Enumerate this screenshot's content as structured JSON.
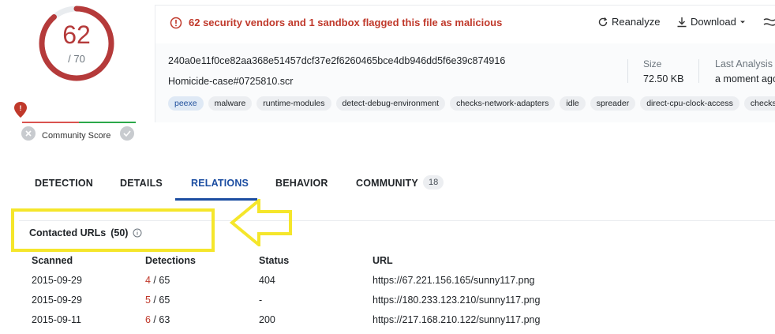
{
  "score": {
    "detected": "62",
    "total": "/ 70",
    "color": "#b53a3a"
  },
  "community": {
    "label": "Community Score"
  },
  "banner": {
    "alert_text": "62 security vendors and 1 sandbox flagged this file as malicious",
    "reanalyze_label": "Reanalyze",
    "download_label": "Download"
  },
  "file": {
    "hash": "240a0e11f0ce82aa368e51457dcf37e2f6260465bce4db946dd5f6e39c874916",
    "name": "Homicide-case#0725810.scr",
    "size_label": "Size",
    "size_value": "72.50 KB",
    "last_label": "Last Analysis",
    "last_value": "a moment ago",
    "tags": [
      "peexe",
      "malware",
      "runtime-modules",
      "detect-debug-environment",
      "checks-network-adapters",
      "idle",
      "spreader",
      "direct-cpu-clock-access",
      "checks"
    ]
  },
  "tabs": {
    "detection": "DETECTION",
    "details": "DETAILS",
    "relations": "RELATIONS",
    "behavior": "BEHAVIOR",
    "community": "COMMUNITY",
    "community_count": "18"
  },
  "contacted": {
    "title": "Contacted URLs",
    "count": "(50)"
  },
  "table": {
    "headers": {
      "scanned": "Scanned",
      "detections": "Detections",
      "status": "Status",
      "url": "URL"
    },
    "rows": [
      {
        "scanned": "2015-09-29",
        "det": "4",
        "det_total": " / 65",
        "status": "404",
        "url": "https://67.221.156.165/sunny117.png"
      },
      {
        "scanned": "2015-09-29",
        "det": "5",
        "det_total": " / 65",
        "status": "-",
        "url": "https://180.233.123.210/sunny117.png"
      },
      {
        "scanned": "2015-09-11",
        "det": "6",
        "det_total": " / 63",
        "status": "200",
        "url": "https://217.168.210.122/sunny117.png"
      }
    ]
  },
  "colors": {
    "accent": "#1b4da1",
    "danger": "#c0392b",
    "highlight": "#f5e62b"
  }
}
